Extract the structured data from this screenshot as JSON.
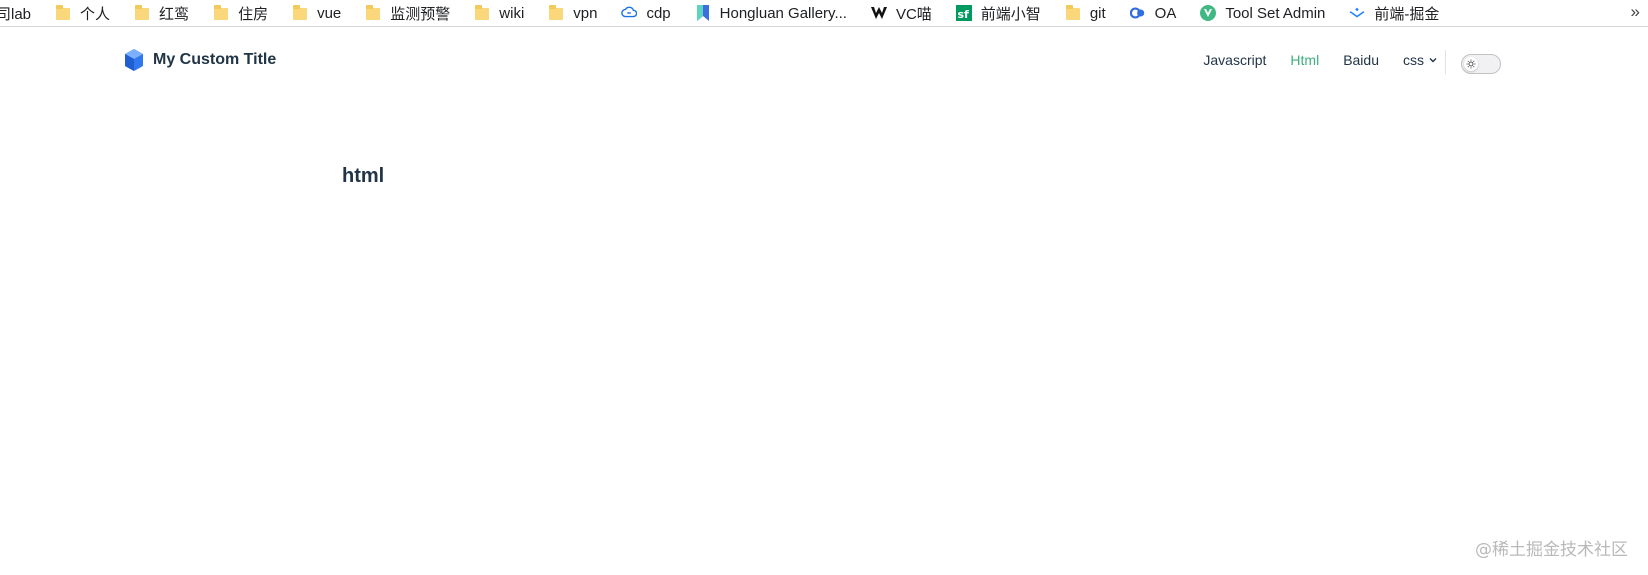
{
  "bookmarks": [
    {
      "label": "司lab",
      "icon": "none"
    },
    {
      "label": "个人",
      "icon": "folder-icon"
    },
    {
      "label": "红鸾",
      "icon": "folder-icon"
    },
    {
      "label": "住房",
      "icon": "folder-icon"
    },
    {
      "label": "vue",
      "icon": "folder-icon"
    },
    {
      "label": "监测预警",
      "icon": "folder-icon"
    },
    {
      "label": "wiki",
      "icon": "folder-icon"
    },
    {
      "label": "vpn",
      "icon": "folder-icon"
    },
    {
      "label": "cdp",
      "icon": "cloud-link-icon"
    },
    {
      "label": "Hongluan Gallery...",
      "icon": "bookmark-ribbon-icon"
    },
    {
      "label": "VC喵",
      "icon": "vc-logo-icon"
    },
    {
      "label": "前端小智",
      "icon": "sf-logo-icon"
    },
    {
      "label": "git",
      "icon": "folder-icon"
    },
    {
      "label": "OA",
      "icon": "oa-logo-icon"
    },
    {
      "label": "Tool Set Admin",
      "icon": "vue-logo-icon"
    },
    {
      "label": "前端-掘金",
      "icon": "juejin-logo-icon"
    }
  ],
  "overflow_label": "»",
  "site": {
    "title": "My Custom Title"
  },
  "nav": [
    {
      "label": "Javascript",
      "active": false
    },
    {
      "label": "Html",
      "active": true
    },
    {
      "label": "Baidu",
      "active": false
    },
    {
      "label": "css",
      "active": false,
      "dropdown": true
    }
  ],
  "theme_toggle": {
    "icon": "sun-icon"
  },
  "page": {
    "heading": "html"
  },
  "watermark": "@稀土掘金技术社区",
  "colors": {
    "accent": "#3eaf7c",
    "text": "#213547"
  }
}
